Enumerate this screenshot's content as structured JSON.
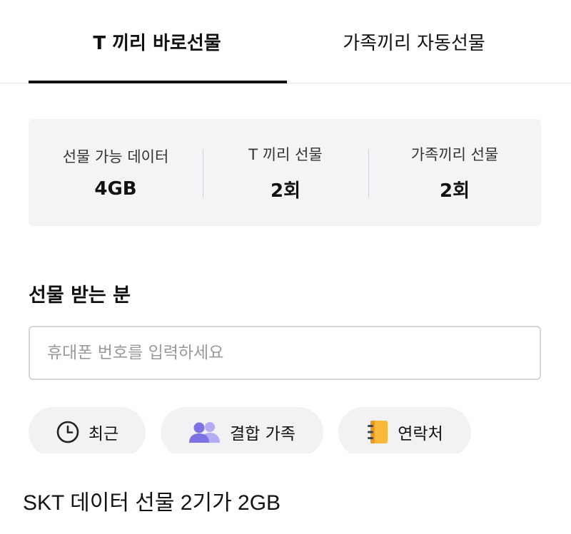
{
  "tabs": [
    {
      "label": "T 끼리 바로선물",
      "active": true
    },
    {
      "label": "가족끼리 자동선물",
      "active": false
    }
  ],
  "summary": [
    {
      "label": "선물 가능 데이터",
      "value": "4GB"
    },
    {
      "label": "T 끼리 선물",
      "value": "2회"
    },
    {
      "label": "가족끼리 선물",
      "value": "2회"
    }
  ],
  "recipient": {
    "title": "선물 받는 분",
    "placeholder": "휴대폰 번호를 입력하세요",
    "value": ""
  },
  "chips": [
    {
      "label": "최근",
      "icon": "clock-icon"
    },
    {
      "label": "결합 가족",
      "icon": "family-icon"
    },
    {
      "label": "연락처",
      "icon": "contacts-book-icon"
    }
  ],
  "colors": {
    "accent": "#111111",
    "card_bg": "#f4f4f6",
    "chip_bg": "#f2f2f4",
    "family_icon": "#8b80e8",
    "contacts_icon": "#f5b731"
  },
  "caption": "SKT 데이터 선물 2기가 2GB"
}
